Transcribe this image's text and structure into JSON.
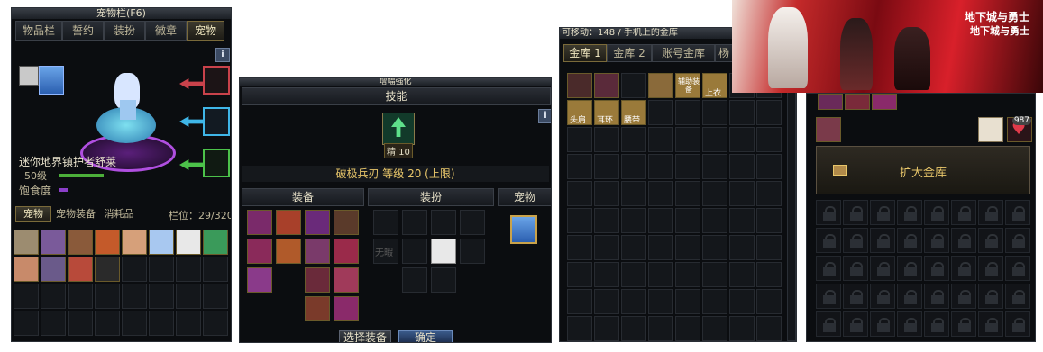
{
  "pet_window": {
    "title": "宠物栏(F6)",
    "tabs": [
      "物品栏",
      "誓约",
      "装扮",
      "徽章",
      "宠物"
    ],
    "active_tab": "宠物",
    "info_label": "i",
    "pet_name": "迷你地界镇护者舒莱",
    "level_text": "50级",
    "satiety_label": "饱食度",
    "subtabs": [
      "宠物",
      "宠物装备",
      "消耗品"
    ],
    "slots_text": "栏位：29/320"
  },
  "skill_window": {
    "title": "增幅强化",
    "skills_header": "技能",
    "skill_badge": "精 10",
    "skill_line": "破极兵刃 等级 20 (上限)",
    "info_label": "i",
    "columns": {
      "equipment": "装备",
      "avatar": "装扮",
      "pet": "宠物"
    },
    "avatar_slot_text": "无暇",
    "select_button": "选择装备",
    "confirm_button": "确定"
  },
  "storage_window": {
    "title": "可移动：148 / 手机上的金库",
    "tabs": [
      "金库 1",
      "金库 2",
      "账号金库"
    ],
    "tab_extra": "杨",
    "item_tags": [
      "辅助装备",
      "上衣",
      "头肩",
      "耳环",
      "腰带"
    ]
  },
  "account_storage": {
    "expand_button": "扩大金库",
    "count_badge": "987"
  },
  "banner": {
    "logo_text": [
      "地下城与勇士",
      "地下城与勇士"
    ]
  },
  "colors": {
    "gold": "#e8c66a",
    "green_bar": "#4caf3a",
    "purple_bar": "#8b3fc9",
    "panel_bg": "#0b0d10"
  }
}
